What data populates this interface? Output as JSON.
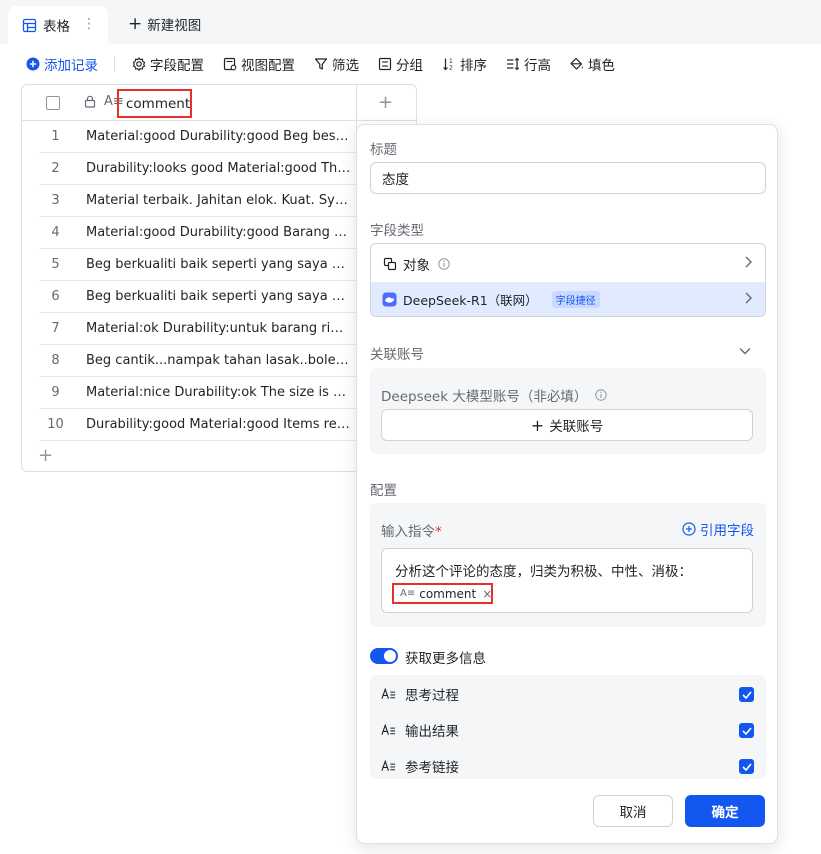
{
  "tabs": {
    "active_label": "表格",
    "more_icon": "⋮",
    "new_view_label": "新建视图"
  },
  "toolbar": {
    "add_record": "添加记录",
    "field_config": "字段配置",
    "view_config": "视图配置",
    "filter": "筛选",
    "group": "分组",
    "sort": "排序",
    "row_height": "行高",
    "fill_color": "填色"
  },
  "table": {
    "column_name": "comment",
    "type_icon": "A≡",
    "rows": [
      {
        "index": "1",
        "comment": "Material:good Durability:good Beg besar..."
      },
      {
        "index": "2",
        "comment": "Durability:looks good Material:good The ..."
      },
      {
        "index": "3",
        "comment": "Material terbaik. Jahitan elok. Kuat. Sy ..."
      },
      {
        "index": "4",
        "comment": "Material:good Durability:good Barang se..."
      },
      {
        "index": "5",
        "comment": "Beg berkualiti baik seperti yang saya na..."
      },
      {
        "index": "6",
        "comment": "Beg berkualiti baik seperti yang saya na..."
      },
      {
        "index": "7",
        "comment": "Material:ok Durability:untuk barang ring..."
      },
      {
        "index": "8",
        "comment": "Beg cantik...nampak tahan lasak..boleh l..."
      },
      {
        "index": "9",
        "comment": "Material:nice Durability:ok The size is ac..."
      },
      {
        "index": "10",
        "comment": "Durability:good Material:good Items rec..."
      }
    ]
  },
  "panel": {
    "title_label": "标题",
    "title_value": "态度",
    "field_type_label": "字段类型",
    "type_object": "对象",
    "type_deepseek": "DeepSeek-R1（联网）",
    "type_badge": "字段捷径",
    "linked_account_label": "关联账号",
    "account_field_label": "Deepseek 大模型账号（非必填）",
    "link_account_button": "关联账号",
    "config_label": "配置",
    "input_instruction_label": "输入指令",
    "required_mark": "*",
    "reference_field": "引用字段",
    "prompt_text": "分析这个评论的态度，归类为积极、中性、消极：",
    "chip_type_icon": "A≡",
    "chip_label": "comment",
    "chip_remove": "×",
    "more_info_label": "获取更多信息",
    "options": [
      {
        "label": "思考过程",
        "checked": true
      },
      {
        "label": "输出结果",
        "checked": true
      },
      {
        "label": "参考链接",
        "checked": true
      }
    ],
    "cancel_button": "取消",
    "confirm_button": "确定"
  },
  "colors": {
    "primary": "#1456f0",
    "highlight": "#e5302e",
    "selected_row": "#e1eaff"
  }
}
